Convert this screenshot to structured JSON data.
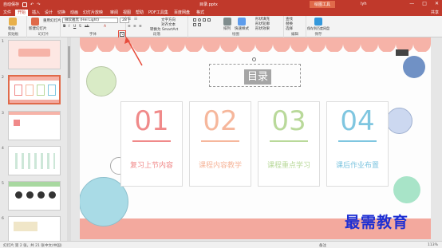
{
  "titlebar": {
    "quick_access": "自动保存",
    "doc_title": "目录.pptx",
    "tools_label": "绘图工具",
    "user": "lyh",
    "minimize": "—",
    "maximize": "□",
    "close": "✕"
  },
  "tabs": [
    "文件",
    "开始",
    "插入",
    "设计",
    "切换",
    "动画",
    "幻灯片放映",
    "审阅",
    "视图",
    "帮助",
    "PDF工具集",
    "百度网盘",
    "格式"
  ],
  "tab_active_index": 1,
  "share": "共享",
  "ribbon": {
    "groups": [
      "剪贴板",
      "幻灯片",
      "字体",
      "段落",
      "绘图",
      "编辑",
      "保存"
    ],
    "paste": "粘贴",
    "new_slide": "新建幻灯片",
    "reuse_slide": "重用幻灯片",
    "font_name": "微软雅黑 (Hei Light)",
    "font_size": "28",
    "text_direction": "文字方向",
    "align_text": "对齐文本",
    "smartart": "转换为 SmartArt",
    "arrange": "排列",
    "quick_styles": "快速样式",
    "shape_fill": "形状填充",
    "shape_outline": "形状轮廓",
    "shape_effects": "形状效果",
    "find": "查找",
    "replace": "替换",
    "select": "选择",
    "save_to_baidu": "保存到百度网盘",
    "launcher_glyph": "↘"
  },
  "thumbnails": [
    "1",
    "2",
    "3",
    "4",
    "5",
    "6"
  ],
  "slide": {
    "title": "目录",
    "cards": [
      {
        "num": "01",
        "label": "复习上节内容",
        "color": "#f08a8a"
      },
      {
        "num": "02",
        "label": "课程内容教学",
        "color": "#f6b79c"
      },
      {
        "num": "03",
        "label": "课程重点学习",
        "color": "#b9d99a"
      },
      {
        "num": "04",
        "label": "课后作业布置",
        "color": "#7fc6e0"
      }
    ]
  },
  "status": {
    "slide_info": "幻灯片 第 2 张，共 21 张",
    "language": "中文(中国)",
    "notes": "备注",
    "zoom": "113%"
  },
  "watermark": "最需教育",
  "colors": {
    "accent": "#c0392b",
    "scallop": "#f6b3a8",
    "highlight_arrow": "#e74c3c"
  }
}
